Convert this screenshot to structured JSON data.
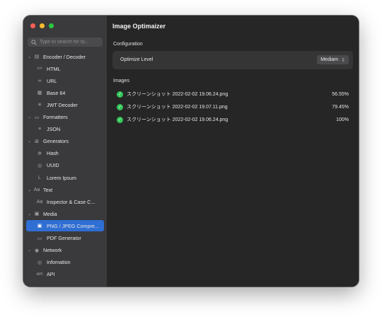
{
  "window": {
    "traffic_lights": [
      "close",
      "minimize",
      "zoom"
    ]
  },
  "search": {
    "placeholder": "Type to search for to...",
    "icon": "search-icon"
  },
  "sidebar": {
    "items": [
      {
        "type": "group",
        "label": "Encoder / Decoder",
        "icon": "encoder-icon"
      },
      {
        "type": "item",
        "label": "HTML",
        "icon": "code-icon"
      },
      {
        "type": "item",
        "label": "URL",
        "icon": "link-icon"
      },
      {
        "type": "item",
        "label": "Base 64",
        "icon": "base64-icon"
      },
      {
        "type": "item",
        "label": "JWT Decoder",
        "icon": "jwt-icon"
      },
      {
        "type": "group",
        "label": "Formatters",
        "icon": "formatter-icon"
      },
      {
        "type": "item",
        "label": "JSON",
        "icon": "json-icon"
      },
      {
        "type": "group",
        "label": "Generators",
        "icon": "generator-icon"
      },
      {
        "type": "item",
        "label": "Hash",
        "icon": "hash-icon"
      },
      {
        "type": "item",
        "label": "UUID",
        "icon": "uuid-icon"
      },
      {
        "type": "item",
        "label": "Lorem Ipsum",
        "icon": "lorem-icon"
      },
      {
        "type": "group",
        "label": "Text",
        "icon": "text-icon"
      },
      {
        "type": "item",
        "label": "Inspector & Case C...",
        "icon": "inspector-icon"
      },
      {
        "type": "group",
        "label": "Media",
        "icon": "media-icon"
      },
      {
        "type": "item",
        "label": "PNG / JPEG Compre...",
        "icon": "image-icon",
        "selected": true
      },
      {
        "type": "item",
        "label": "PDF Generator",
        "icon": "pdf-icon"
      },
      {
        "type": "group",
        "label": "Network",
        "icon": "network-icon"
      },
      {
        "type": "item",
        "label": "Infomation",
        "icon": "info-icon"
      },
      {
        "type": "item",
        "label": "API",
        "icon": "api-icon"
      }
    ]
  },
  "main": {
    "title": "Image Optimaizer",
    "configuration_label": "Configuration",
    "optimize_level_label": "Optimize Level",
    "optimize_level_value": "Mediam",
    "images_label": "Images",
    "images": [
      {
        "name": "スクリーンショット 2022-02-02 19.06.24.png",
        "percent": "56.55%"
      },
      {
        "name": "スクリーンショット 2022-02-02 19.07.11.png",
        "percent": "79.45%"
      },
      {
        "name": "スクリーンショット 2022-02-02 19.06.24.png",
        "percent": "100%"
      }
    ]
  },
  "colors": {
    "sidebar_bg": "#3a3a3c",
    "main_bg": "#262626",
    "accent": "#2f6ed3",
    "success": "#34c759"
  }
}
